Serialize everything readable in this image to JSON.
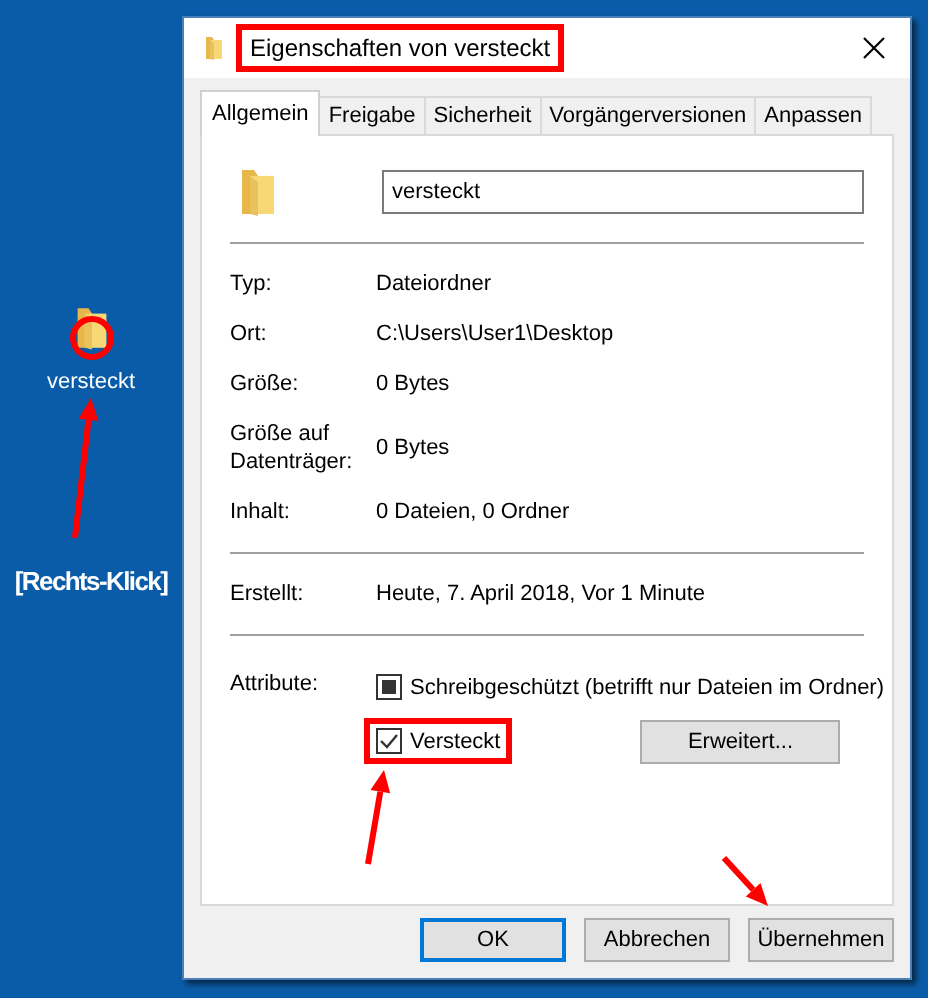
{
  "desktop": {
    "icon_label": "versteckt",
    "annotation": "[Rechts-Klick]"
  },
  "window": {
    "title": "Eigenschaften von versteckt",
    "title_highlighted": true
  },
  "tabs": [
    {
      "label": "Allgemein",
      "selected": true
    },
    {
      "label": "Freigabe",
      "selected": false
    },
    {
      "label": "Sicherheit",
      "selected": false
    },
    {
      "label": "Vorgängerversionen",
      "selected": false
    },
    {
      "label": "Anpassen",
      "selected": false
    }
  ],
  "name_field": {
    "value": "versteckt"
  },
  "groups": [
    [
      {
        "label": "Typ:",
        "value": "Dateiordner"
      },
      {
        "label": "Ort:",
        "value": "C:\\Users\\User1\\Desktop"
      },
      {
        "label": "Größe:",
        "value": "0 Bytes"
      },
      {
        "label": "Größe auf Datenträger:",
        "value": "0 Bytes"
      },
      {
        "label": "Inhalt:",
        "value": "0 Dateien, 0 Ordner"
      }
    ],
    [
      {
        "label": "Erstellt:",
        "value": "Heute, 7. April 2018, Vor 1 Minute"
      }
    ]
  ],
  "attributes": {
    "label": "Attribute:",
    "items": [
      {
        "label": "Schreibgeschützt (betrifft nur Dateien im Ordner)",
        "indeterminate": true,
        "highlighted": false
      },
      {
        "label": "Versteckt",
        "checked": true,
        "indeterminate": false,
        "highlighted": true
      }
    ],
    "advanced_button": "Erweitert..."
  },
  "buttons": [
    {
      "label": "OK",
      "default": true
    },
    {
      "label": "Abbrechen",
      "default": false
    },
    {
      "label": "Übernehmen",
      "default": false
    }
  ]
}
